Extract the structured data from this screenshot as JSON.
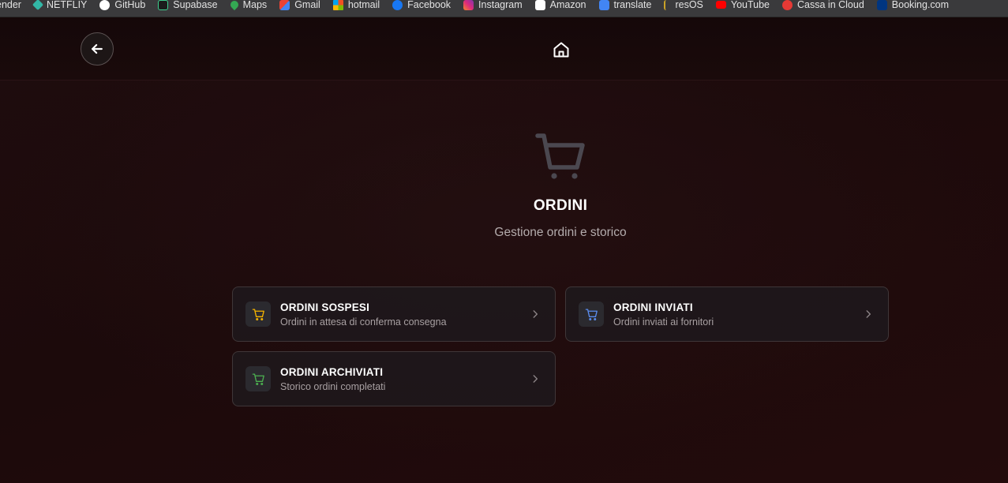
{
  "bookmarks": [
    {
      "label": "ender",
      "icon": "generic-icon",
      "color": "#3a3a3c"
    },
    {
      "label": "NETFLIY",
      "icon": "netlify-icon",
      "color": "#32b7a6"
    },
    {
      "label": "GitHub",
      "icon": "github-icon",
      "color": "#ffffff"
    },
    {
      "label": "Supabase",
      "icon": "supabase-icon",
      "color": "#3ecf8e"
    },
    {
      "label": "Maps",
      "icon": "maps-pin-icon",
      "color": "#34a853"
    },
    {
      "label": "Gmail",
      "icon": "gmail-icon",
      "color": "#ea4335"
    },
    {
      "label": "hotmail",
      "icon": "microsoft-icon",
      "color": "#f25022"
    },
    {
      "label": "Facebook",
      "icon": "facebook-icon",
      "color": "#1877f2"
    },
    {
      "label": "Instagram",
      "icon": "instagram-icon",
      "color": "#e1306c"
    },
    {
      "label": "Amazon",
      "icon": "amazon-icon",
      "color": "#ffffff"
    },
    {
      "label": "translate",
      "icon": "translate-icon",
      "color": "#4285f4"
    },
    {
      "label": "resOS",
      "icon": "resos-icon",
      "color": "#c9a227"
    },
    {
      "label": "YouTube",
      "icon": "youtube-icon",
      "color": "#ff0000"
    },
    {
      "label": "Cassa in Cloud",
      "icon": "cassa-icon",
      "color": "#e53935"
    },
    {
      "label": "Booking.com",
      "icon": "booking-icon",
      "color": "#003580"
    }
  ],
  "page": {
    "title": "ORDINI",
    "subtitle": "Gestione ordini e storico"
  },
  "cards": [
    {
      "title": "ORDINI SOSPESI",
      "subtitle": "Ordini in attesa di conferma consegna",
      "icon_color": "#f5b400"
    },
    {
      "title": "ORDINI INVIATI",
      "subtitle": "Ordini inviati ai fornitori",
      "icon_color": "#5b8def"
    },
    {
      "title": "ORDINI ARCHIVIATI",
      "subtitle": "Storico ordini completati",
      "icon_color": "#4caf50"
    }
  ],
  "colors": {
    "background": "#1c0a0b",
    "card_border": "#3f3638",
    "hero_icon": "#4b4850"
  }
}
